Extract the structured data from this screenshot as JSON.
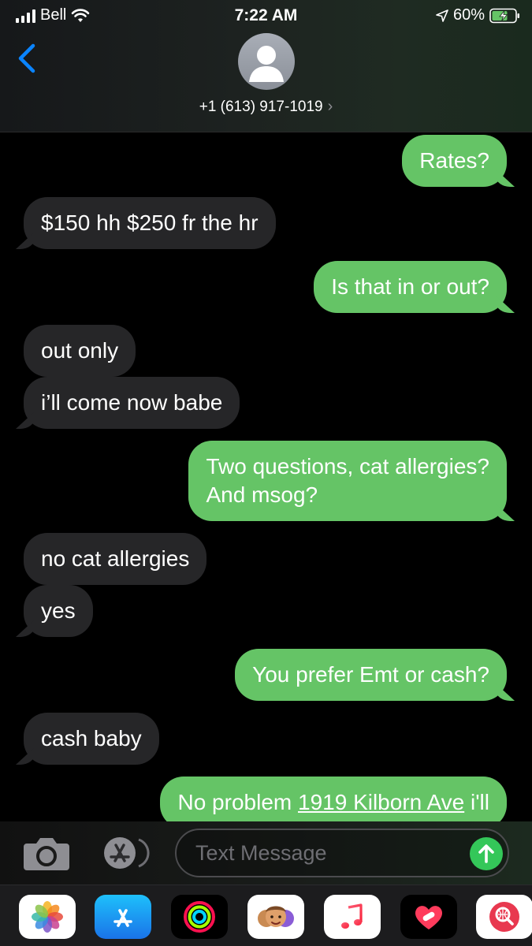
{
  "status_bar": {
    "carrier": "Bell",
    "time": "7:22 AM",
    "battery_percent": "60%"
  },
  "header": {
    "contact_number": "+1 (613) 917-1019",
    "back_icon": "chevron-left-icon",
    "info_chevron": "›"
  },
  "messages": [
    {
      "direction": "outgoing",
      "text": "Rates?"
    },
    {
      "direction": "incoming",
      "text": "$150 hh $250 fr the hr"
    },
    {
      "direction": "outgoing",
      "text": "Is that in or out?"
    },
    {
      "direction": "incoming",
      "text": "out only"
    },
    {
      "direction": "incoming",
      "text": "i’ll come now babe"
    },
    {
      "direction": "outgoing",
      "lines": [
        "Two questions, cat allergies?",
        "And msog?"
      ]
    },
    {
      "direction": "incoming",
      "text": "no cat allergies"
    },
    {
      "direction": "incoming",
      "text": "yes"
    },
    {
      "direction": "outgoing",
      "text": "You prefer Emt or cash?"
    },
    {
      "direction": "incoming",
      "text": "cash baby"
    },
    {
      "direction": "outgoing",
      "text_before": "No problem ",
      "link": "1919 Kilborn Ave",
      "text_after": " i'll"
    }
  ],
  "input": {
    "placeholder": "Text Message",
    "camera_icon": "camera-icon",
    "apps_icon": "app-store-icon",
    "send_icon": "arrow-up-icon"
  },
  "app_drawer": {
    "apps": [
      "photos-icon",
      "app-store-icon",
      "activity-icon",
      "memoji-icon",
      "music-icon",
      "heart-app-icon",
      "web-search-icon"
    ]
  },
  "colors": {
    "outgoing_bubble": "#65c466",
    "incoming_bubble": "#262628",
    "accent_blue": "#0a84ff",
    "send_green": "#34c759"
  }
}
